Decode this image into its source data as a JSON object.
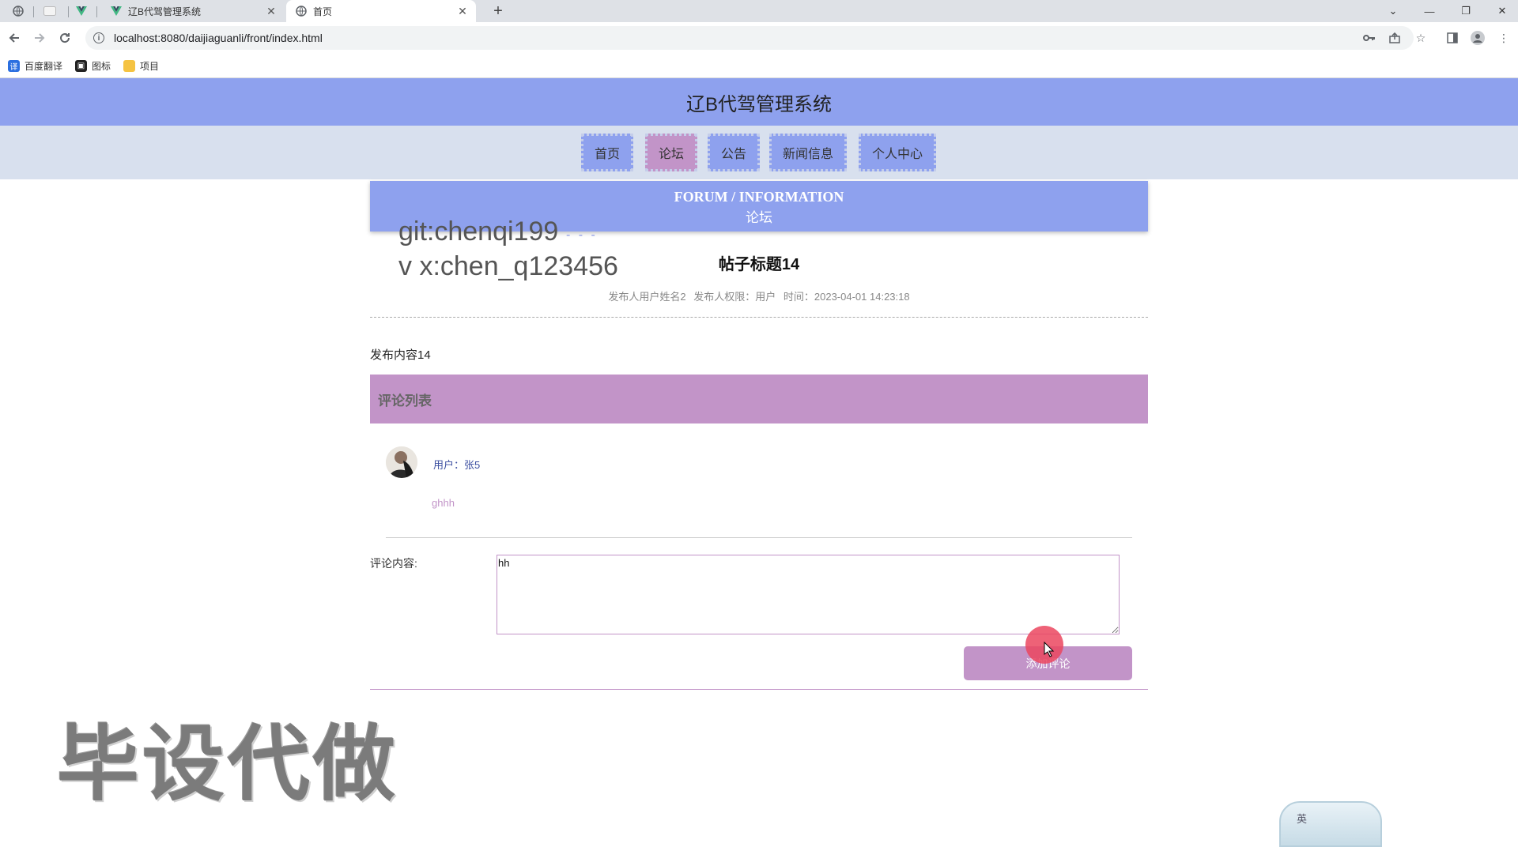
{
  "browser": {
    "tabs": [
      {
        "title": "",
        "icon": "globe-icon"
      },
      {
        "title": "",
        "icon": "blank-page-icon"
      },
      {
        "title": "",
        "icon": "vue-icon"
      },
      {
        "title": "辽B代驾管理系统",
        "icon": "vue-icon"
      },
      {
        "title": "首页",
        "icon": "globe-icon",
        "active": true
      }
    ],
    "url": "localhost:8080/daijiaguanli/front/index.html",
    "bookmarks": [
      {
        "label": "百度翻译",
        "icon": "translate-icon",
        "color": "#2b6fe0"
      },
      {
        "label": "图标",
        "icon": "bookmark-app-icon",
        "color": "#222222"
      },
      {
        "label": "项目",
        "icon": "folder-icon",
        "color": "#f5c342"
      }
    ]
  },
  "site": {
    "title": "辽B代驾管理系统",
    "nav": [
      "首页",
      "论坛",
      "公告",
      "新闻信息",
      "个人中心"
    ],
    "active_nav": "论坛"
  },
  "banner": {
    "title_en": "FORUM / INFORMATION",
    "title_cn": "论坛"
  },
  "overlay": {
    "line1": "git:chenqi199",
    "line2": "v x:chen_q123456",
    "dashes": "- - -",
    "big_watermark": "毕设代做",
    "ime_label": "英"
  },
  "post": {
    "title": "帖子标题14",
    "meta_author": "发布人用户姓名2",
    "meta_role": "发布人权限：用户",
    "meta_time": "时间：2023-04-01 14:23:18",
    "content": "发布内容14"
  },
  "comments": {
    "header": "评论列表",
    "items": [
      {
        "user": "用户：张5",
        "text": "ghhh"
      }
    ]
  },
  "comment_form": {
    "label": "评论内容:",
    "value": "hh",
    "submit_label": "添加评论"
  },
  "colors": {
    "header_blue": "#8ea1ee",
    "nav_bg": "#d8e0ee",
    "accent_purple": "#c294c8"
  }
}
